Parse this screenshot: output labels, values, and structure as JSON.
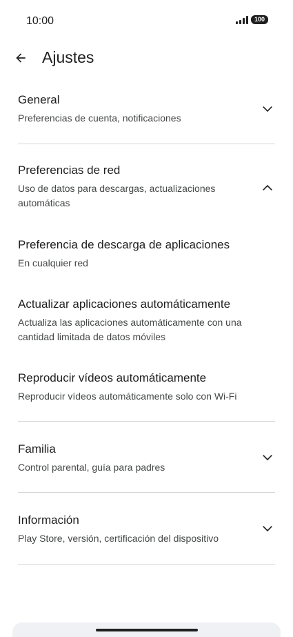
{
  "status": {
    "time": "10:00",
    "battery": "100",
    "signal_icon": "signal-icon"
  },
  "header": {
    "title": "Ajustes",
    "back_icon": "arrow-back-icon"
  },
  "sections": {
    "general": {
      "title": "General",
      "subtitle": "Preferencias de cuenta, notificaciones",
      "expanded": false
    },
    "network": {
      "title": "Preferencias de red",
      "subtitle": "Uso de datos para descargas, actualizaciones automáticas",
      "expanded": true,
      "items": [
        {
          "title": "Preferencia de descarga de aplicaciones",
          "subtitle": "En cualquier red"
        },
        {
          "title": "Actualizar aplicaciones automáticamente",
          "subtitle": "Actualiza las aplicaciones automáticamente con una cantidad limitada de datos móviles"
        },
        {
          "title": "Reproducir vídeos automáticamente",
          "subtitle": "Reproducir vídeos automáticamente solo con Wi-Fi"
        }
      ]
    },
    "family": {
      "title": "Familia",
      "subtitle": "Control parental, guía para padres",
      "expanded": false
    },
    "info": {
      "title": "Información",
      "subtitle": "Play Store, versión, certificación del dispositivo",
      "expanded": false
    }
  },
  "colors": {
    "text_primary": "#1f1f1f",
    "text_secondary": "#444746",
    "divider": "#d7d7d7",
    "nav_bar": "#f0f1f4"
  }
}
